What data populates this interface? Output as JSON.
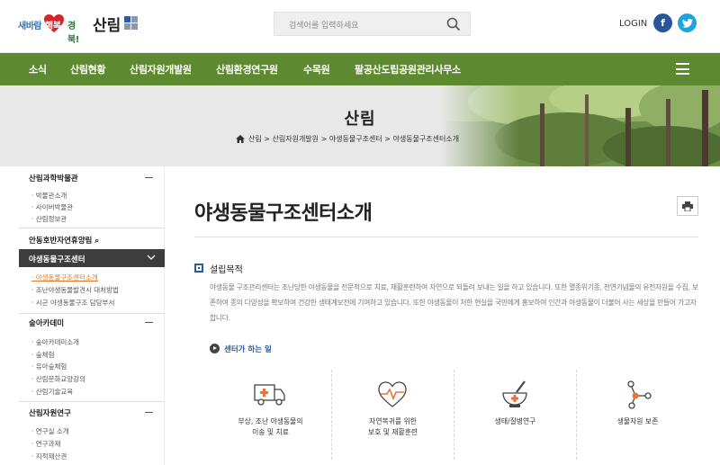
{
  "header": {
    "logo": {
      "part1": "새바람",
      "part2": "행복",
      "part3": "경북!",
      "title": "산림"
    },
    "search_placeholder": "검색어를 입력하세요",
    "login": "LOGIN",
    "facebook": "f",
    "twitter": "t"
  },
  "gnb": {
    "items": [
      "소식",
      "산림현황",
      "산림자원개발원",
      "산림환경연구원",
      "수목원",
      "팔공산도립공원관리사무소"
    ]
  },
  "banner": {
    "title": "산림",
    "breadcrumb": "산림 > 산림자원개발원 > 야생동물구조센터 > 야생동물구조센터소개"
  },
  "sidebar": {
    "sections": [
      {
        "title": "산림과학박물관",
        "items": [
          "박물관소개",
          "사이버박물관",
          "산림정보관"
        ]
      },
      {
        "title": "안동호반자연휴양림 ⌕"
      },
      {
        "title": "야생동물구조센터",
        "items": [
          "야생동물구조센터소개",
          "조난야생동물발견시 대처방법",
          "시군 야생동물구조 담당부서"
        ]
      },
      {
        "title": "숲아카데미",
        "items": [
          "숲아카데미소개",
          "숲체험",
          "유아숲체험",
          "산림문화교양강의",
          "산림기술교육"
        ]
      },
      {
        "title": "산림자원연구",
        "items": [
          "연구실 소개",
          "연구과제",
          "지적재산권"
        ]
      }
    ]
  },
  "content": {
    "title": "야생동물구조센터소개",
    "section_title": "설립목적",
    "paragraph": "야생동물 구조관리센터는 조난당한 야생동물을 전문적으로 치료, 재활훈련하여 자연으로 되돌려 보내는 일을 하고 있습니다. 또한 멸종위기종, 천연기념물의 유전자원을 수집, 보존하여 종의 다양성을 확보하여 건강한 생태계보전에 기여하고 있습니다. 또한 야생동물이 처한 현실을 국민에게 홍보하여 인간과 야생동물이 더불어 사는 세상을 만들어 가고자 합니다.",
    "subsection_title": "센터가 하는 일",
    "cards": [
      {
        "icon": "ambulance-icon",
        "line1": "부상, 조난 야생동물의",
        "line2": "이송 및 치료"
      },
      {
        "icon": "heart-pulse-icon",
        "line1": "자연복귀를 위한",
        "line2": "보호 및 재활훈련"
      },
      {
        "icon": "mortar-pestle-icon",
        "line1": "생태/질병연구",
        "line2": ""
      },
      {
        "icon": "molecule-icon",
        "line1": "생물자원 보존",
        "line2": ""
      }
    ]
  },
  "colors": {
    "gnb": "#5d8a30",
    "accent": "#2a5b9c",
    "sidebar_active": "#3d3d3d",
    "icon_orange": "#e8743b"
  }
}
